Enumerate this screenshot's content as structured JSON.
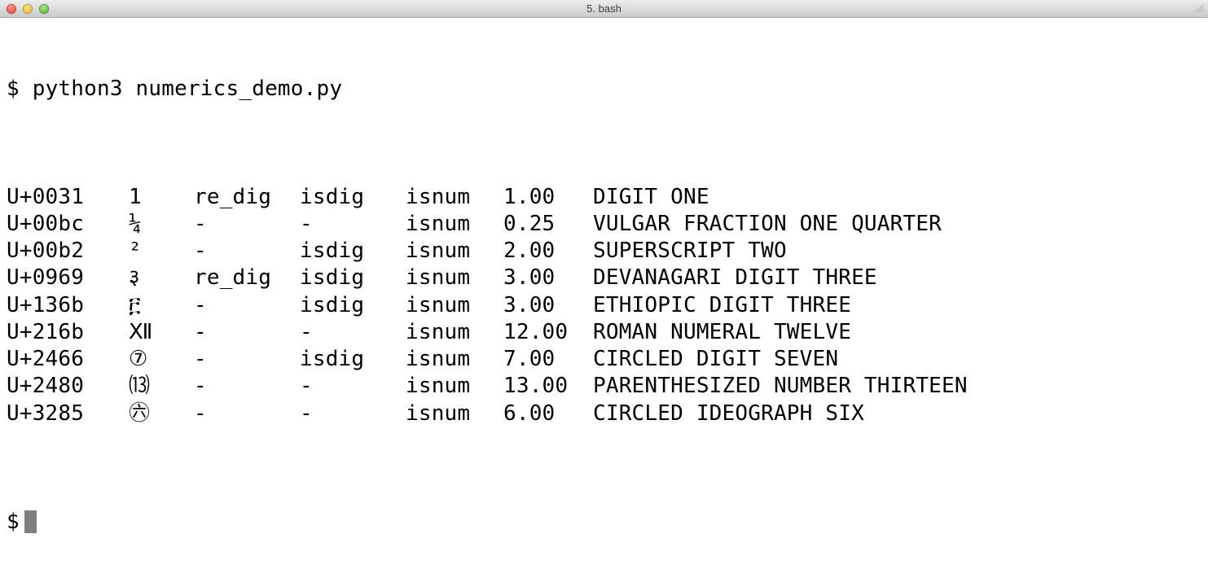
{
  "window": {
    "title": "5. bash"
  },
  "terminal": {
    "prompt": "$",
    "command": "python3 numerics_demo.py",
    "rows": [
      {
        "code": "U+0031",
        "char": "1",
        "re_dig": "re_dig",
        "isdig": "isdig",
        "isnum": "isnum",
        "value": "1.00",
        "name": "DIGIT ONE"
      },
      {
        "code": "U+00bc",
        "char": "¼",
        "re_dig": "-",
        "isdig": "-",
        "isnum": "isnum",
        "value": "0.25",
        "name": "VULGAR FRACTION ONE QUARTER"
      },
      {
        "code": "U+00b2",
        "char": "²",
        "re_dig": "-",
        "isdig": "isdig",
        "isnum": "isnum",
        "value": "2.00",
        "name": "SUPERSCRIPT TWO"
      },
      {
        "code": "U+0969",
        "char": "३",
        "re_dig": "re_dig",
        "isdig": "isdig",
        "isnum": "isnum",
        "value": "3.00",
        "name": "DEVANAGARI DIGIT THREE"
      },
      {
        "code": "U+136b",
        "char": "፫",
        "re_dig": "-",
        "isdig": "isdig",
        "isnum": "isnum",
        "value": "3.00",
        "name": "ETHIOPIC DIGIT THREE"
      },
      {
        "code": "U+216b",
        "char": "Ⅻ",
        "re_dig": "-",
        "isdig": "-",
        "isnum": "isnum",
        "value": "12.00",
        "name": "ROMAN NUMERAL TWELVE"
      },
      {
        "code": "U+2466",
        "char": "⑦",
        "re_dig": "-",
        "isdig": "isdig",
        "isnum": "isnum",
        "value": "7.00",
        "name": "CIRCLED DIGIT SEVEN"
      },
      {
        "code": "U+2480",
        "char": "⒀",
        "re_dig": "-",
        "isdig": "-",
        "isnum": "isnum",
        "value": "13.00",
        "name": "PARENTHESIZED NUMBER THIRTEEN"
      },
      {
        "code": "U+3285",
        "char": "㊅",
        "re_dig": "-",
        "isdig": "-",
        "isnum": "isnum",
        "value": "6.00",
        "name": "CIRCLED IDEOGRAPH SIX"
      }
    ],
    "final_prompt": "$"
  }
}
